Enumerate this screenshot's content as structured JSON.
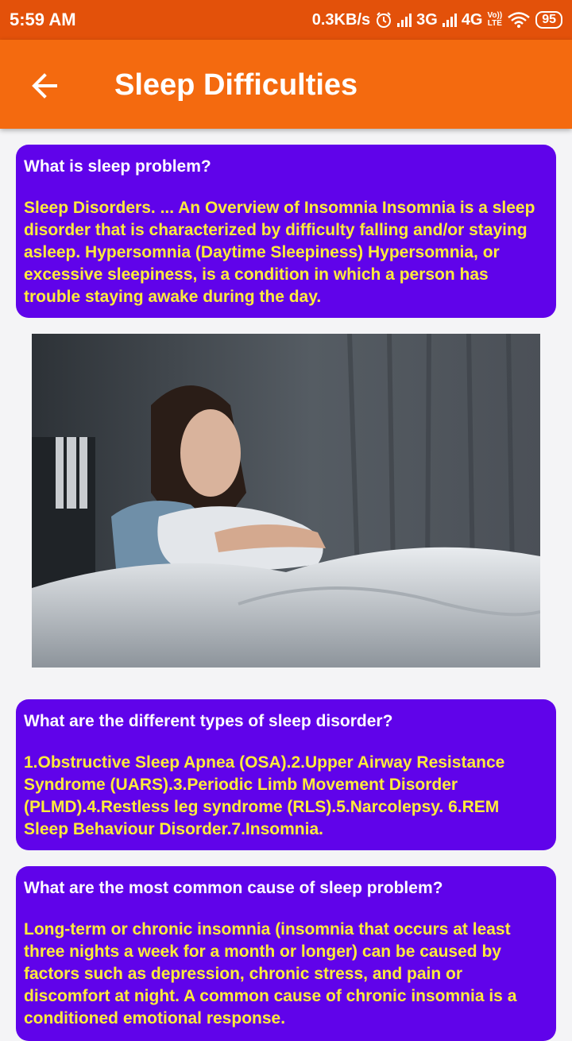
{
  "status_bar": {
    "time": "5:59 AM",
    "net_speed": "0.3KB/s",
    "net_3g": "3G",
    "net_4g": "4G",
    "volte_top": "Vo))",
    "volte_bottom": "LTE",
    "battery": "95"
  },
  "app_bar": {
    "title": "Sleep Difficulties"
  },
  "cards": [
    {
      "question": "What is sleep problem?",
      "answer": "Sleep Disorders. ... An Overview of Insomnia Insomnia is a sleep disorder that is characterized by difficulty falling and/or staying asleep. Hypersomnia (Daytime Sleepiness) Hypersomnia, or excessive sleepiness, is a condition in which a person has trouble staying awake during the day."
    },
    {
      "question": "What are the different types of sleep disorder?",
      "answer": "1.Obstructive Sleep Apnea (OSA).2.Upper Airway Resistance Syndrome (UARS).3.Periodic Limb Movement Disorder (PLMD).4.Restless leg syndrome (RLS).5.Narcolepsy. 6.REM Sleep Behaviour Disorder.7.Insomnia."
    },
    {
      "question": "What are the most common cause of sleep problem?",
      "answer": "Long-term or chronic insomnia (insomnia that occurs at least three nights a week for a month or longer) can be caused by factors such as depression, chronic stress, and pain or discomfort at night. A common cause of chronic insomnia is a conditioned emotional response."
    }
  ],
  "colors": {
    "status_bar": "#e3510a",
    "app_bar": "#f46a0f",
    "card_background": "#6003ea",
    "question_text": "#ffffff",
    "answer_text": "#ffeb3b"
  }
}
